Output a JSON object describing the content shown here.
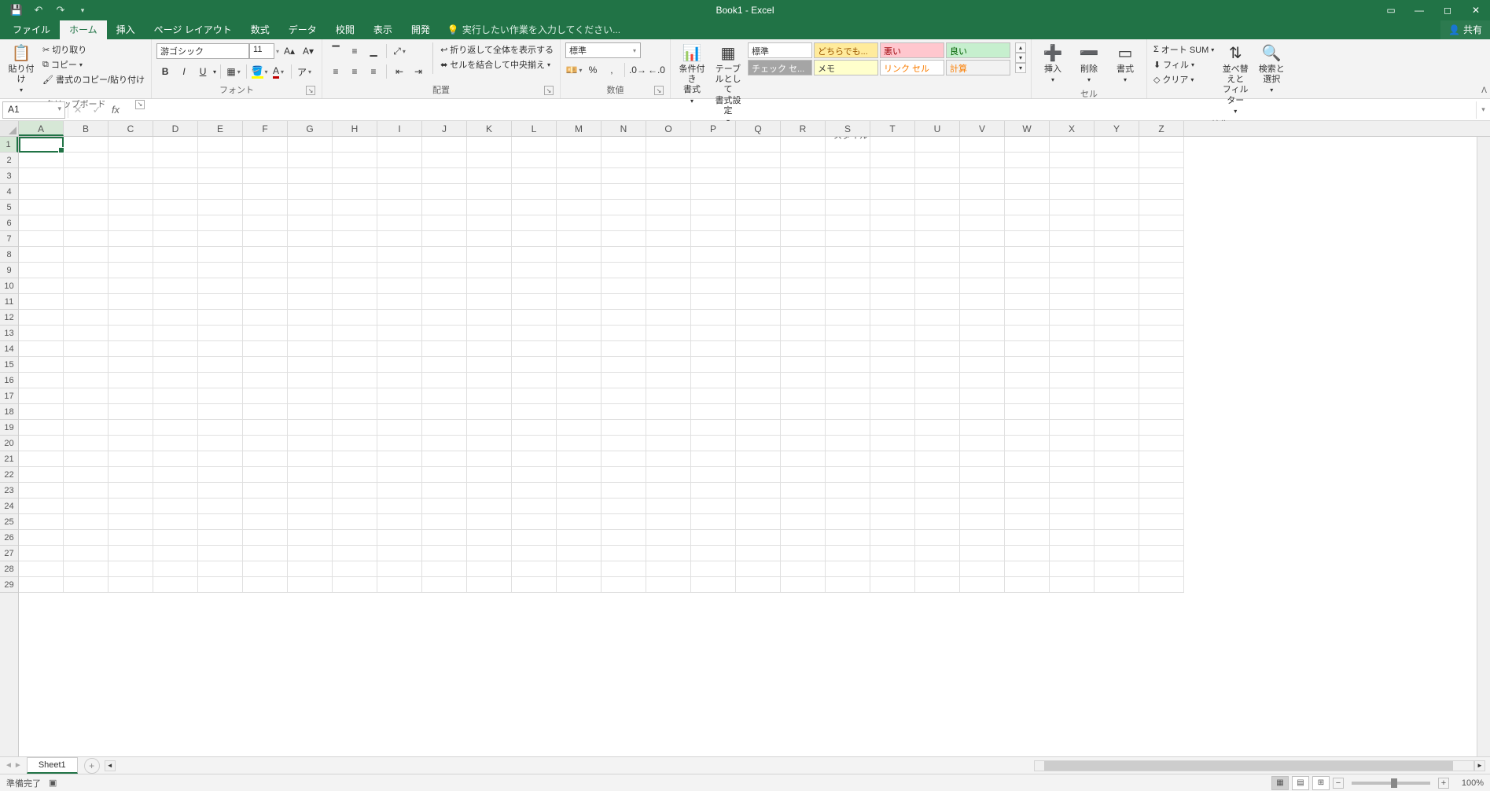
{
  "title": "Book1 - Excel",
  "qat": {
    "save": "保存",
    "undo": "元に戻す",
    "redo": "やり直し"
  },
  "tabs": {
    "file": "ファイル",
    "home": "ホーム",
    "insert": "挿入",
    "pagelayout": "ページ レイアウト",
    "formulas": "数式",
    "data": "データ",
    "review": "校閲",
    "view": "表示",
    "developer": "開発"
  },
  "tell_me": "実行したい作業を入力してください...",
  "share": "共有",
  "ribbon": {
    "clipboard": {
      "label": "クリップボード",
      "paste": "貼り付け",
      "cut": "切り取り",
      "copy": "コピー",
      "format_painter": "書式のコピー/貼り付け"
    },
    "font": {
      "label": "フォント",
      "name": "游ゴシック",
      "size": "11"
    },
    "alignment": {
      "label": "配置",
      "wrap": "折り返して全体を表示する",
      "merge": "セルを結合して中央揃え"
    },
    "number": {
      "label": "数値",
      "format": "標準"
    },
    "styles": {
      "label": "スタイル",
      "conditional": "条件付き\n書式",
      "table": "テーブルとして\n書式設定",
      "s1": "標準",
      "s2": "どちらでも...",
      "s3": "悪い",
      "s4": "良い",
      "s5": "チェック セ...",
      "s6": "メモ",
      "s7": "リンク セル",
      "s8": "計算"
    },
    "cells": {
      "label": "セル",
      "insert": "挿入",
      "delete": "削除",
      "format": "書式"
    },
    "editing": {
      "label": "編集",
      "autosum": "オート SUM",
      "fill": "フィル",
      "clear": "クリア",
      "sort": "並べ替えと\nフィルター",
      "find": "検索と\n選択"
    }
  },
  "name_box": "A1",
  "columns": [
    "A",
    "B",
    "C",
    "D",
    "E",
    "F",
    "G",
    "H",
    "I",
    "J",
    "K",
    "L",
    "M",
    "N",
    "O",
    "P",
    "Q",
    "R",
    "S",
    "T",
    "U",
    "V",
    "W",
    "X",
    "Y",
    "Z"
  ],
  "rows": [
    "1",
    "2",
    "3",
    "4",
    "5",
    "6",
    "7",
    "8",
    "9",
    "10",
    "11",
    "12",
    "13",
    "14",
    "15",
    "16",
    "17",
    "18",
    "19",
    "20",
    "21",
    "22",
    "23",
    "24",
    "25",
    "26",
    "27",
    "28",
    "29"
  ],
  "sheet": "Sheet1",
  "status": "準備完了",
  "zoom": "100%"
}
